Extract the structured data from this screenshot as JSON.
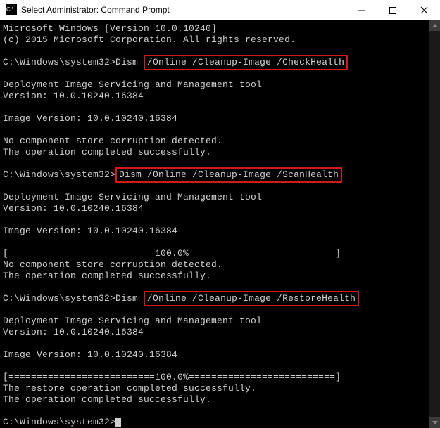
{
  "titlebar": {
    "icon_name": "cmd-prompt-icon",
    "title": "Select Administrator: Command Prompt"
  },
  "console": {
    "header_line1": "Microsoft Windows [Version 10.0.10240]",
    "header_line2": "(c) 2015 Microsoft Corporation. All rights reserved.",
    "sections": [
      {
        "prompt": "C:\\Windows\\system32>",
        "cmd_prefix": "Dism ",
        "cmd_highlight": "/Online /Cleanup-Image /CheckHealth",
        "tool_title": "Deployment Image Servicing and Management tool",
        "tool_version": "Version: 10.0.10240.16384",
        "image_version": "Image Version: 10.0.10240.16384",
        "progress": "",
        "result1": "No component store corruption detected.",
        "result2": "The operation completed successfully."
      },
      {
        "prompt": "C:\\Windows\\system32>",
        "cmd_prefix": "",
        "cmd_highlight": "Dism /Online /Cleanup-Image /ScanHealth",
        "tool_title": "Deployment Image Servicing and Management tool",
        "tool_version": "Version: 10.0.10240.16384",
        "image_version": "Image Version: 10.0.10240.16384",
        "progress": "[==========================100.0%==========================]",
        "result1": "No component store corruption detected.",
        "result2": "The operation completed successfully."
      },
      {
        "prompt": "C:\\Windows\\system32>",
        "cmd_prefix": "Dism ",
        "cmd_highlight": "/Online /Cleanup-Image /RestoreHealth",
        "tool_title": "Deployment Image Servicing and Management tool",
        "tool_version": "Version: 10.0.10240.16384",
        "image_version": "Image Version: 10.0.10240.16384",
        "progress": "[==========================100.0%==========================]",
        "result1": "The restore operation completed successfully.",
        "result2": "The operation completed successfully."
      }
    ],
    "final_prompt": "C:\\Windows\\system32>"
  }
}
